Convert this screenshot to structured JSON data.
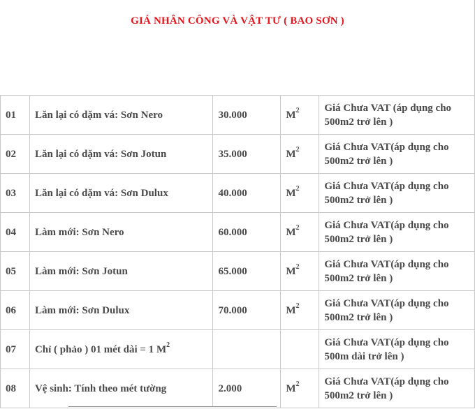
{
  "title": "GIÁ NHÂN CÔNG VÀ VẬT TƯ ( BAO SƠN )",
  "title_color": "#e8141b",
  "unit_base": "M",
  "unit_sup": "2",
  "rows": [
    {
      "no": "01",
      "desc": "Lăn lại có dặm vá: Sơn Nero",
      "price": "30.000",
      "unit": "M",
      "unit_sup": "2",
      "note": "Giá Chưa VAT (áp dụng cho 500m2 trở lên )"
    },
    {
      "no": "02",
      "desc": "Lăn lại có dặm vá: Sơn Jotun",
      "price": "35.000",
      "unit": "M",
      "unit_sup": "2",
      "note": "Giá Chưa VAT(áp dụng cho 500m2 trở lên )"
    },
    {
      "no": "03",
      "desc": "Lăn lại có dặm vá: Sơn Dulux",
      "price": "40.000",
      "unit": "M",
      "unit_sup": "2",
      "note": "Giá Chưa VAT(áp dụng cho 500m2 trở lên )"
    },
    {
      "no": "04",
      "desc": "Làm mới: Sơn Nero",
      "price": "60.000",
      "unit": "M",
      "unit_sup": "2",
      "note": "Giá Chưa VAT(áp dụng cho 500m2 trở lên )"
    },
    {
      "no": "05",
      "desc": "Làm mới: Sơn Jotun",
      "price": "65.000",
      "unit": "M",
      "unit_sup": "2",
      "note": "Giá Chưa VAT(áp dụng cho 500m2 trở lên )"
    },
    {
      "no": "06",
      "desc": "Làm mới: Sơn Dulux",
      "price": "70.000",
      "unit": "M",
      "unit_sup": "2",
      "note": "Giá Chưa VAT(áp dụng cho 500m2 trở lên )"
    },
    {
      "no": "07",
      "desc": "Chỉ ( phảo ) 01 mét dài = 1 M",
      "desc_sup": "2",
      "price": "",
      "unit": "",
      "unit_sup": "",
      "note": "Giá Chưa VAT(áp dụng cho 500m dài trở lên )"
    },
    {
      "no": "08",
      "desc": "Vệ sinh: Tính theo mét tường",
      "price": "2.000",
      "unit": "M",
      "unit_sup": "2",
      "note": "Giá Chưa VAT(áp dụng cho 500m2 trở lên )"
    }
  ]
}
